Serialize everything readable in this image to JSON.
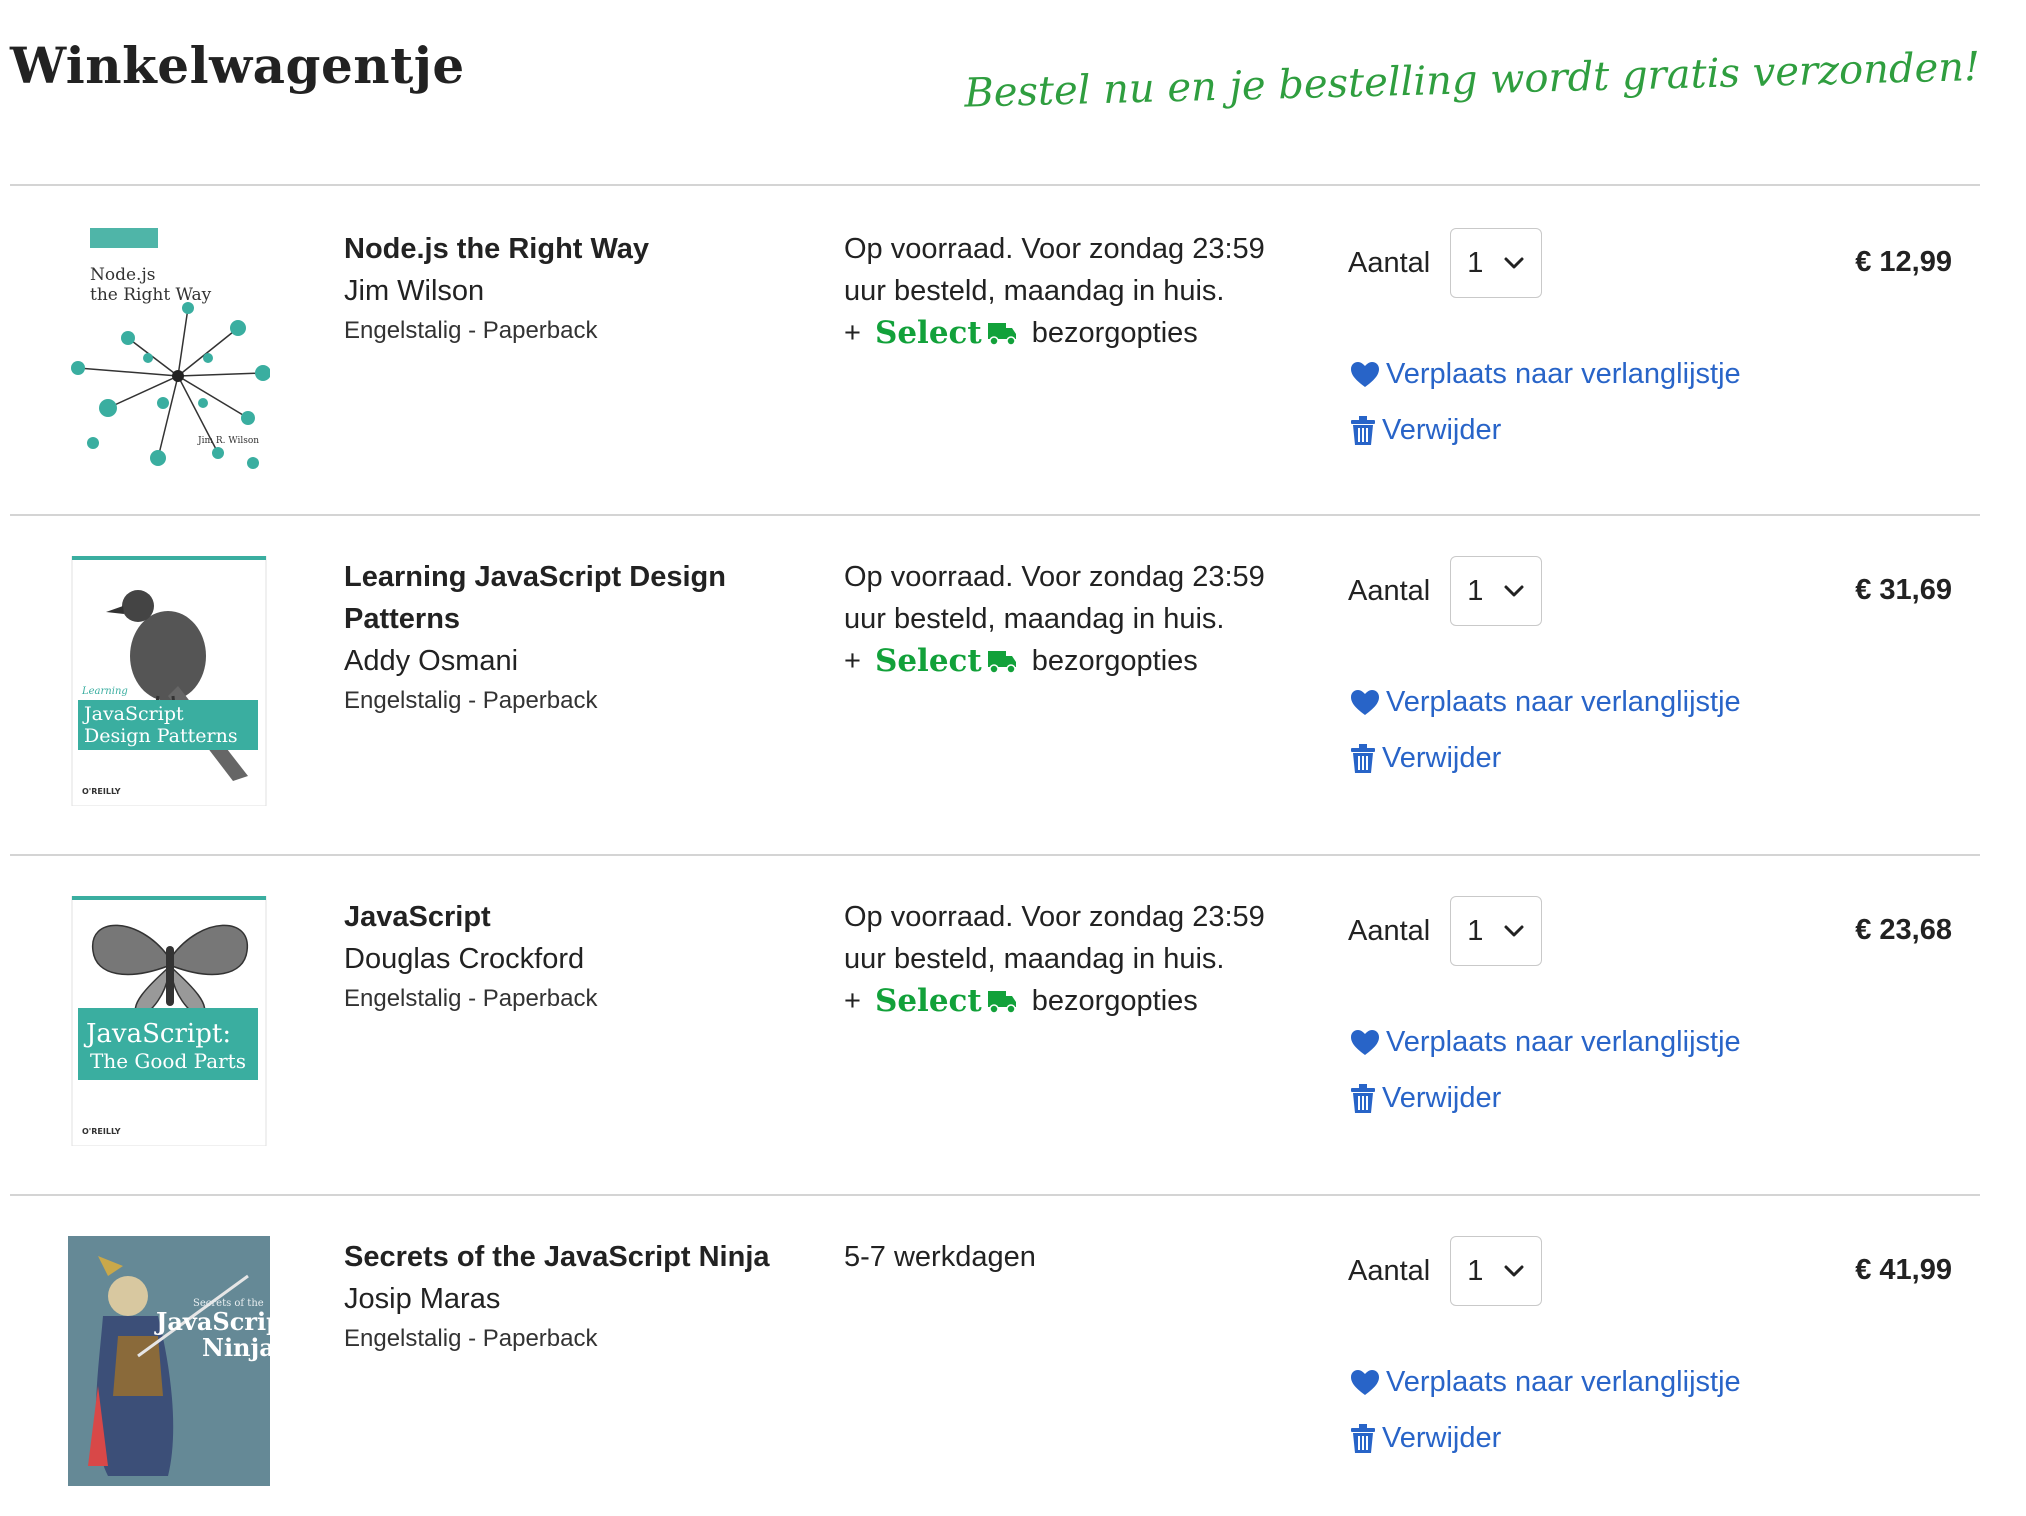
{
  "header": {
    "title": "Winkelwagentje",
    "promo": "Bestel nu en je bestelling wordt gratis verzonden!"
  },
  "labels": {
    "quantity": "Aantal",
    "wishlist": "Verplaats naar verlanglijstje",
    "remove": "Verwijder",
    "select_plus": "+",
    "select_brand": "Select",
    "select_suffix": "bezorgopties"
  },
  "items": [
    {
      "title": "Node.js the Right Way",
      "author": "Jim Wilson",
      "format": "Engelstalig - Paperback",
      "availability": "Op voorraad. Voor zondag 23:59 uur besteld, maandag in huis.",
      "has_select": true,
      "quantity": "1",
      "price": "€ 12,99",
      "cover": {
        "title_line1": "Node.js",
        "title_line2": "the Right Way",
        "author": "Jim R. Wilson"
      }
    },
    {
      "title": "Learning JavaScript Design Patterns",
      "author": "Addy Osmani",
      "format": "Engelstalig - Paperback",
      "availability": "Op voorraad. Voor zondag 23:59 uur besteld, maandag in huis.",
      "has_select": true,
      "quantity": "1",
      "price": "€ 31,69",
      "cover": {
        "prefix": "Learning",
        "title_line1": "JavaScript",
        "title_line2": "Design Patterns",
        "publisher": "O'REILLY"
      }
    },
    {
      "title": "JavaScript",
      "author": "Douglas Crockford",
      "format": "Engelstalig - Paperback",
      "availability": "Op voorraad. Voor zondag 23:59 uur besteld, maandag in huis.",
      "has_select": true,
      "quantity": "1",
      "price": "€ 23,68",
      "cover": {
        "title_line1": "JavaScript:",
        "title_line2": "The Good Parts",
        "publisher": "O'REILLY"
      }
    },
    {
      "title": "Secrets of the JavaScript Ninja",
      "author": "Josip Maras",
      "format": "Engelstalig - Paperback",
      "availability": "5-7 werkdagen",
      "has_select": false,
      "quantity": "1",
      "price": "€ 41,99",
      "cover": {
        "prefix": "Secrets of the",
        "title_line1": "JavaScript",
        "title_line2": "Ninja"
      }
    }
  ],
  "colors": {
    "link": "#2864c8",
    "promo": "#2f9e3f",
    "select_brand": "#12a13a",
    "divider": "#d4d4d4"
  }
}
